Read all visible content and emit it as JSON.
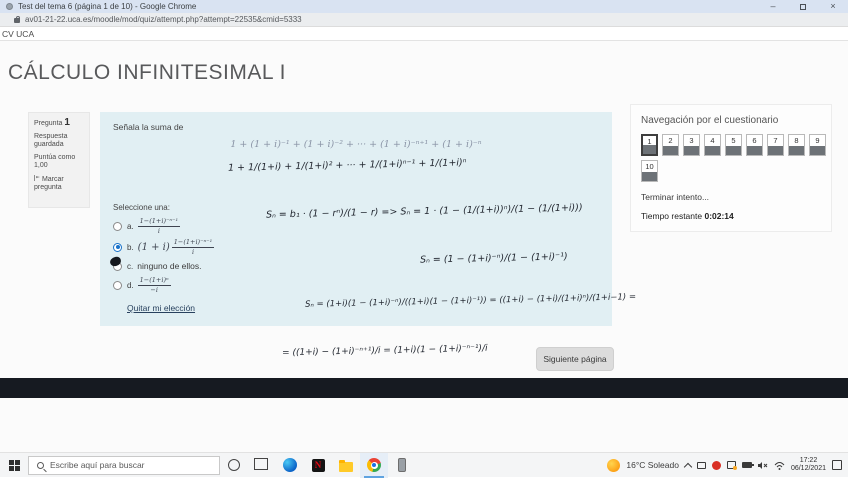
{
  "window": {
    "tab_title": "Test del tema 6 (página 1 de 10) - Google Chrome",
    "url": "av01-21-22.uca.es/moodle/mod/quiz/attempt.php?attempt=22535&cmid=5333",
    "site_nav": "CV UCA",
    "close_glyph": "×",
    "minimize_glyph": "–"
  },
  "page": {
    "heading": "CÁLCULO INFINITESIMAL I"
  },
  "question_info": {
    "label": "Pregunta",
    "number": "1",
    "status": "Respuesta guardada",
    "grade_line1": "Puntúa como",
    "grade_line2": "1,00",
    "flag_label": "Marcar pregunta"
  },
  "question": {
    "prompt": "Señala la suma de",
    "formula": "1 + (1 + i)⁻¹ + (1 + i)⁻² + ··· + (1 + i)⁻ⁿ⁺¹ + (1 + i)⁻ⁿ",
    "select_label": "Seleccione una:",
    "options": [
      {
        "letter": "a.",
        "prefix": "",
        "num": "1−(1+i)⁻ⁿ⁻¹",
        "den": "i",
        "selected": false,
        "inked": false
      },
      {
        "letter": "b.",
        "prefix": "(1 + i)",
        "num": "1−(1+i)⁻ⁿ⁻¹",
        "den": "i",
        "selected": true,
        "inked": false
      },
      {
        "letter": "c.",
        "prefix": "ninguno de ellos.",
        "num": "",
        "den": "",
        "selected": false,
        "inked": true
      },
      {
        "letter": "d.",
        "prefix": "",
        "num": "1−(1+i)ⁿ",
        "den": "−i",
        "selected": false,
        "inked": false
      }
    ],
    "clear_choice": "Quitar mi elección"
  },
  "handwriting": {
    "lines": [
      "1 + 1/(1+i) + 1/(1+i)² + ··· + 1/(1+i)ⁿ⁻¹ + 1/(1+i)ⁿ",
      "Sₙ = b₁ · (1 − rⁿ)/(1 − r)  =>  Sₙ = 1 · (1 − (1/(1+i))ⁿ)/(1 − (1/(1+i)))",
      "Sₙ = (1 − (1+i)⁻ⁿ)/(1 − (1+i)⁻¹)",
      "Sₙ = (1+i)(1 − (1+i)⁻ⁿ)/((1+i)(1 − (1+i)⁻¹)) = ((1+i) − (1+i)/(1+i)ⁿ)/(1+i−1) =",
      "= ((1+i) − (1+i)⁻ⁿ⁺¹)/i = (1+i)(1 − (1+i)⁻ⁿ⁻¹)/i"
    ]
  },
  "quiz_nav": {
    "title": "Navegación por el cuestionario",
    "buttons": [
      "1",
      "2",
      "3",
      "4",
      "5",
      "6",
      "7",
      "8",
      "9",
      "10"
    ],
    "current": "1",
    "finish_label": "Terminar intento...",
    "time_label": "Tiempo restante ",
    "time_value": "0:02:14"
  },
  "next_button_label": "Siguiente página",
  "taskbar": {
    "search_placeholder": "Escribe aquí para buscar",
    "netflix_glyph": "N",
    "weather": "16°C  Soleado",
    "mute_glyph": "🔇",
    "time": "17:22",
    "date": "06/12/2021"
  }
}
